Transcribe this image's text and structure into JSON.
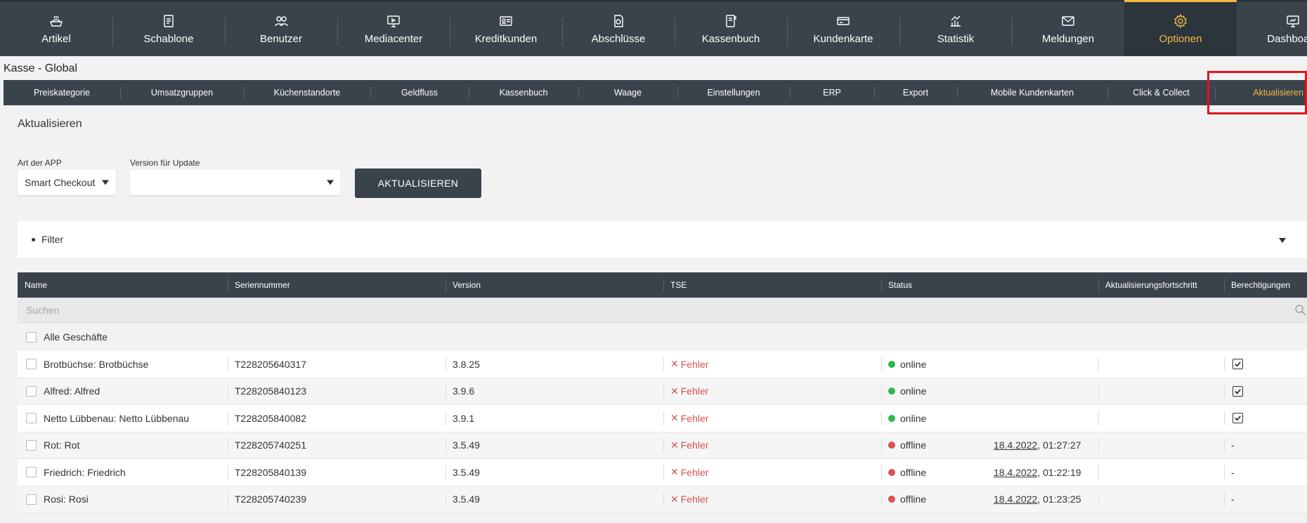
{
  "nav": [
    {
      "label": "Artikel",
      "icon": "bread-basket-icon"
    },
    {
      "label": "Schablone",
      "icon": "template-icon"
    },
    {
      "label": "Benutzer",
      "icon": "users-icon"
    },
    {
      "label": "Mediacenter",
      "icon": "monitor-icon"
    },
    {
      "label": "Kreditkunden",
      "icon": "id-card-icon"
    },
    {
      "label": "Abschlüsse",
      "icon": "document-icon"
    },
    {
      "label": "Kassenbuch",
      "icon": "cashbook-icon"
    },
    {
      "label": "Kundenkarte",
      "icon": "card-icon"
    },
    {
      "label": "Statistik",
      "icon": "chart-icon"
    },
    {
      "label": "Meldungen",
      "icon": "envelope-icon"
    },
    {
      "label": "Optionen",
      "icon": "gear-icon",
      "active": true
    },
    {
      "label": "Dashboard",
      "icon": "dashboard-icon"
    }
  ],
  "breadcrumb": "Kasse - Global",
  "subnav": [
    {
      "label": "Preiskategorie"
    },
    {
      "label": "Umsatzgruppen"
    },
    {
      "label": "Küchenstandorte"
    },
    {
      "label": "Geldfluss"
    },
    {
      "label": "Kassenbuch"
    },
    {
      "label": "Waage"
    },
    {
      "label": "Einstellungen"
    },
    {
      "label": "ERP"
    },
    {
      "label": "Export"
    },
    {
      "label": "Mobile Kundenkarten"
    },
    {
      "label": "Click & Collect"
    },
    {
      "label": "Aktualisieren",
      "active": true
    }
  ],
  "section_title": "Aktualisieren",
  "form": {
    "app_type_label": "Art der APP",
    "app_type_value": "Smart Checkout",
    "version_label": "Version für Update",
    "version_value": "",
    "update_button": "AKTUALISIEREN"
  },
  "filter": {
    "label": "Filter"
  },
  "table": {
    "columns": [
      "Name",
      "Seriennummer",
      "Version",
      "TSE",
      "Status",
      "Aktualisierungsfortschritt",
      "Berechtigungen"
    ],
    "search_placeholder": "Suchen",
    "all_label": "Alle Geschäfte",
    "rows": [
      {
        "name": "Brotbüchse: Brotbüchse",
        "serial": "T228205640317",
        "version": "3.8.25",
        "tse": "Fehler",
        "status": "online",
        "date": "",
        "time": "",
        "perm": "check"
      },
      {
        "name": "Alfred: Alfred",
        "serial": "T228205840123",
        "version": "3.9.6",
        "tse": "Fehler",
        "status": "online",
        "date": "",
        "time": "",
        "perm": "check"
      },
      {
        "name": "Netto Lübbenau: Netto Lübbenau",
        "serial": "T228205840082",
        "version": "3.9.1",
        "tse": "Fehler",
        "status": "online",
        "date": "",
        "time": "",
        "perm": "check"
      },
      {
        "name": "Rot: Rot",
        "serial": "T228205740251",
        "version": "3.5.49",
        "tse": "Fehler",
        "status": "offline",
        "date": "18.4.2022",
        "time": ", 01:27:27",
        "perm": "-"
      },
      {
        "name": "Friedrich: Friedrich",
        "serial": "T228205840139",
        "version": "3.5.49",
        "tse": "Fehler",
        "status": "offline",
        "date": "18.4.2022",
        "time": ", 01:22:19",
        "perm": "-"
      },
      {
        "name": "Rosi: Rosi",
        "serial": "T228205740239",
        "version": "3.5.49",
        "tse": "Fehler",
        "status": "offline",
        "date": "18.4.2022",
        "time": ", 01:23:25",
        "perm": "-"
      }
    ]
  },
  "colors": {
    "accent": "#f5b942",
    "nav_bg": "#3a434c",
    "error": "#d9534f",
    "online": "#2eb84a",
    "highlight": "#e0141e"
  }
}
